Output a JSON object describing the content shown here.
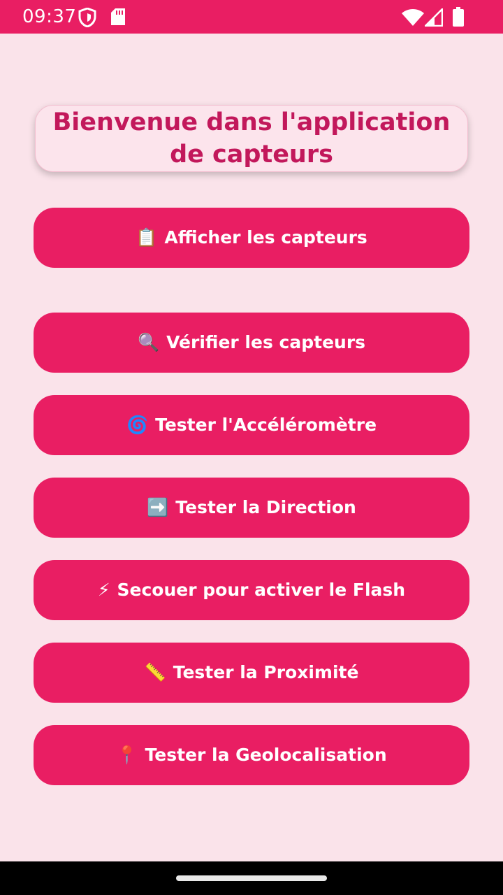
{
  "status_bar": {
    "time": "09:37",
    "color": "#e91e63",
    "icons": [
      "shield-icon",
      "sd-card-icon",
      "wifi-icon",
      "signal-icon",
      "battery-icon"
    ]
  },
  "title_card": {
    "text": "Bienvenue dans l'application de capteurs",
    "text_color": "#c2185b",
    "background": "#fce4ec"
  },
  "buttons": [
    {
      "icon": "📋",
      "icon_name": "clipboard-icon",
      "label": "Afficher les capteurs"
    },
    {
      "icon": "🔍",
      "icon_name": "magnifier-icon",
      "label": "Vérifier les capteurs"
    },
    {
      "icon": "🌀",
      "icon_name": "cyclone-icon",
      "label": "Tester l'Accéléromètre"
    },
    {
      "icon": "➡️",
      "icon_name": "right-arrow-icon",
      "label": "Tester la Direction"
    },
    {
      "icon": "⚡",
      "icon_name": "lightning-icon",
      "label": "Secouer pour activer le Flash"
    },
    {
      "icon": "📏",
      "icon_name": "ruler-icon",
      "label": "Tester la Proximité"
    },
    {
      "icon": "📍",
      "icon_name": "pin-icon",
      "label": "Tester la Geolocalisation"
    }
  ],
  "colors": {
    "accent": "#e91e63",
    "background": "#fae3ea"
  }
}
